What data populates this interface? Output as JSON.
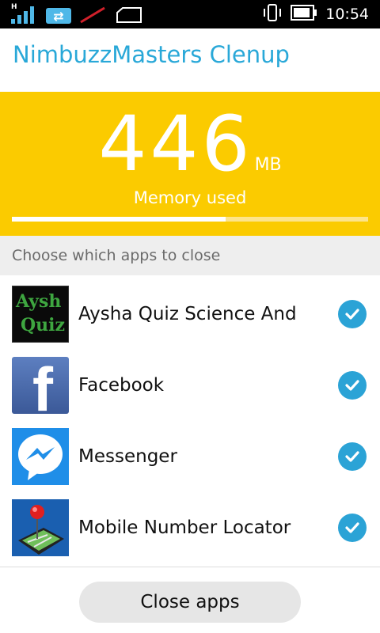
{
  "status_bar": {
    "network_type": "H",
    "time": "10:54",
    "icons": [
      "signal-icon",
      "data-transfer-icon",
      "no-sim-icon",
      "sim-slot-icon",
      "vibrate-icon",
      "battery-icon"
    ]
  },
  "app_title": "NimbuzzMasters Clenup",
  "memory": {
    "value": "446",
    "unit": "MB",
    "label": "Memory used",
    "usage_fraction": 0.6,
    "colors": {
      "panel": "#fbcb00",
      "track": "#fde48a",
      "fill": "#ffffff"
    }
  },
  "section_header": "Choose which apps to close",
  "apps": [
    {
      "name": "Aysha Quiz Science And",
      "icon_text_line1": "Aysh",
      "icon_text_line2": "Quiz",
      "icon": "aysha-quiz-icon",
      "checked": true
    },
    {
      "name": "Facebook",
      "icon_text": "f",
      "icon": "facebook-icon",
      "checked": true
    },
    {
      "name": "Messenger",
      "icon": "messenger-icon",
      "checked": true
    },
    {
      "name": "Mobile Number Locator",
      "icon": "mobile-number-locator-icon",
      "checked": true
    }
  ],
  "close_button": "Close apps",
  "accent_color": "#29a8d8"
}
